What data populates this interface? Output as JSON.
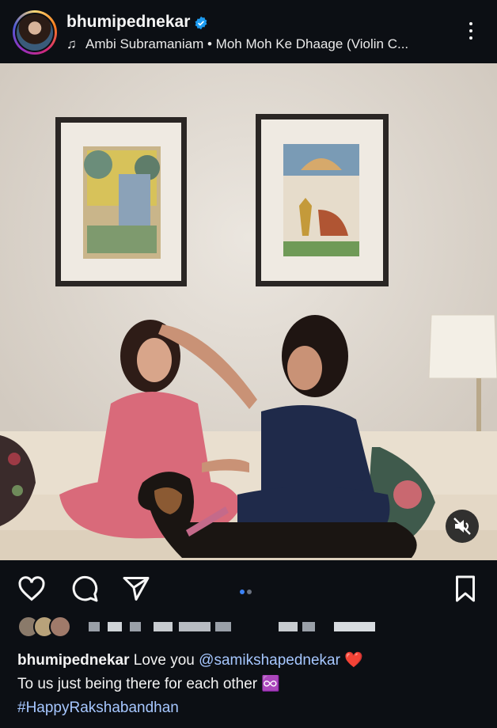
{
  "post": {
    "username": "bhumipednekar",
    "music": "Ambi Subramaniam • Moh Moh Ke Dhaage (Violin C...",
    "caption": {
      "username": "bhumipednekar",
      "text_before": "Love you",
      "mention": "@samikshapednekar",
      "heart": "❤️",
      "line2": "To us just being there for each other",
      "infinity": "♾️",
      "hashtag": "#HappyRakshabandhan"
    },
    "carousel": {
      "current": 1,
      "total": 2
    }
  },
  "icons": {
    "verified": "verified-badge-icon",
    "music": "music-note-icon",
    "more": "more-vertical-icon",
    "mute": "speaker-muted-icon",
    "like": "heart-icon",
    "comment": "comment-icon",
    "share": "paper-plane-icon",
    "save": "bookmark-icon"
  },
  "colors": {
    "background": "#0c0f14",
    "verified": "#1d9bf0",
    "mention": "#a6c7ff",
    "active_dot": "#3b82f6",
    "inactive_dot": "#6b7280"
  }
}
